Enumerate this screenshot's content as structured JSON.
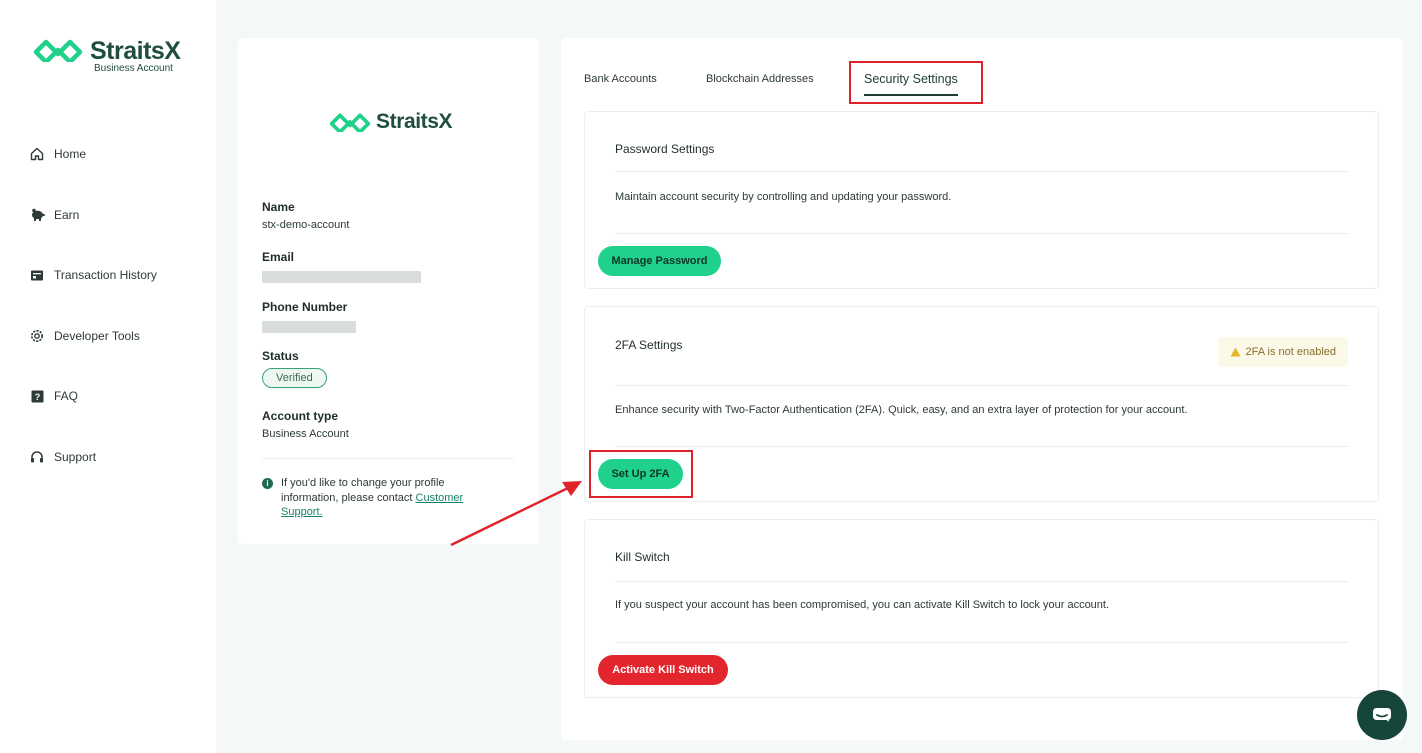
{
  "brand": {
    "name": "StraitsX",
    "subtitle": "Business Account"
  },
  "nav": [
    {
      "label": "Home",
      "icon": "home-icon"
    },
    {
      "label": "Earn",
      "icon": "piggy-bank-icon"
    },
    {
      "label": "Transaction History",
      "icon": "wallet-icon"
    },
    {
      "label": "Developer Tools",
      "icon": "gear-icon"
    },
    {
      "label": "FAQ",
      "icon": "question-icon"
    },
    {
      "label": "Support",
      "icon": "headset-icon"
    }
  ],
  "profile": {
    "logo_text": "StraitsX",
    "name_label": "Name",
    "name_value": "stx-demo-account",
    "email_label": "Email",
    "phone_label": "Phone Number",
    "status_label": "Status",
    "status_value": "Verified",
    "account_type_label": "Account type",
    "account_type_value": "Business Account",
    "note_text": "If you'd like to change your profile information, please contact ",
    "note_link": "Customer Support."
  },
  "tabs": [
    {
      "label": "Bank Accounts"
    },
    {
      "label": "Blockchain Addresses"
    },
    {
      "label": "Security Settings",
      "active": true
    }
  ],
  "password_settings": {
    "title": "Password Settings",
    "description": "Maintain account security by controlling and updating your password.",
    "button_label": "Manage Password"
  },
  "twofa_settings": {
    "title": "2FA Settings",
    "warning": "2FA is not enabled",
    "description": "Enhance security with Two-Factor Authentication (2FA). Quick, easy, and an extra layer of protection for your account.",
    "button_label": "Set Up 2FA"
  },
  "kill_switch": {
    "title": "Kill Switch",
    "description": "If you suspect your account has been compromised, you can activate Kill Switch to lock your account.",
    "button_label": "Activate Kill Switch"
  },
  "colors": {
    "accent_green": "#1fd18a",
    "danger_red": "#e3262d",
    "brand_dark": "#1f4d40",
    "highlight_red": "#e0232b",
    "chat_bg": "#16453a"
  }
}
